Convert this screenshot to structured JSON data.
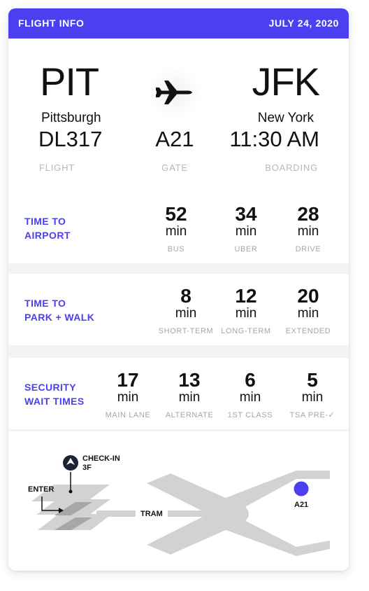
{
  "header": {
    "title": "FLIGHT INFO",
    "date": "JULY 24, 2020"
  },
  "route": {
    "from": {
      "code": "PIT",
      "city": "Pittsburgh"
    },
    "to": {
      "code": "JFK",
      "city": "New York"
    },
    "flight": {
      "value": "DL317",
      "label": "FLIGHT"
    },
    "gate": {
      "value": "A21",
      "label": "GATE"
    },
    "boarding": {
      "value": "11:30 AM",
      "label": "BOARDING"
    }
  },
  "time_to_airport": {
    "label_line1": "TIME TO",
    "label_line2": "AIRPORT",
    "items": [
      {
        "value": "52",
        "unit": "min",
        "label": "BUS"
      },
      {
        "value": "34",
        "unit": "min",
        "label": "UBER"
      },
      {
        "value": "28",
        "unit": "min",
        "label": "DRIVE"
      }
    ]
  },
  "time_to_park": {
    "label_line1": "TIME TO",
    "label_line2": "PARK + WALK",
    "items": [
      {
        "value": "8",
        "unit": "min",
        "label": "SHORT-TERM"
      },
      {
        "value": "12",
        "unit": "min",
        "label": "LONG-TERM"
      },
      {
        "value": "20",
        "unit": "min",
        "label": "EXTENDED"
      }
    ]
  },
  "security": {
    "label_line1": "SECURITY",
    "label_line2": "WAIT TIMES",
    "items": [
      {
        "value": "17",
        "unit": "min",
        "label": "MAIN LANE"
      },
      {
        "value": "13",
        "unit": "min",
        "label": "ALTERNATE"
      },
      {
        "value": "6",
        "unit": "min",
        "label": "1ST CLASS"
      },
      {
        "value": "5",
        "unit": "min",
        "label": "TSA PRE-✓"
      }
    ]
  },
  "map": {
    "checkin_line1": "CHECK-IN",
    "checkin_line2": "3F",
    "enter": "ENTER",
    "tram": "TRAM",
    "gate": "A21",
    "accent": "#4c3ff0",
    "shape_color": "#d2d2d2"
  }
}
